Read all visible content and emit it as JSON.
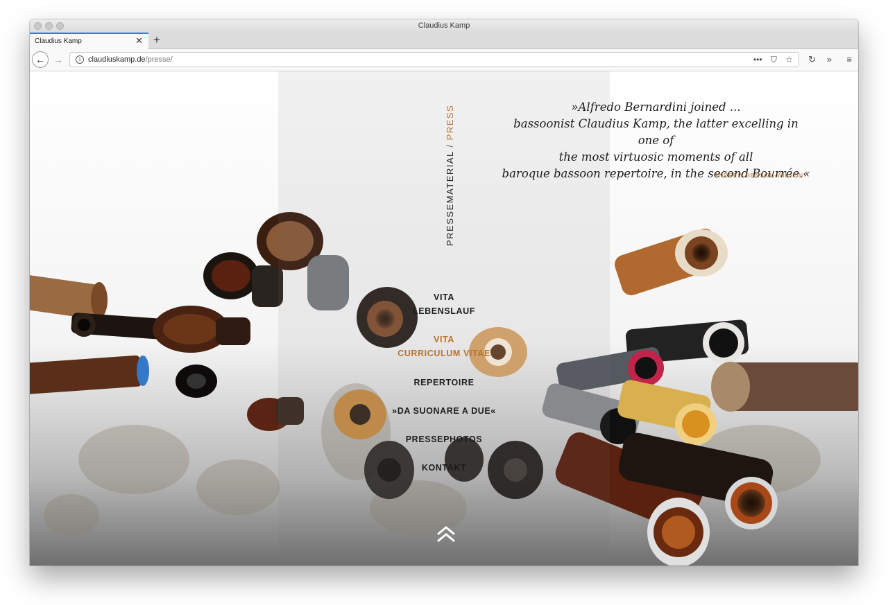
{
  "window": {
    "title": "Claudius Kamp"
  },
  "tab": {
    "label": "Claudius Kamp",
    "close_icon": "close-icon",
    "new_tab_icon": "plus-icon"
  },
  "navbar": {
    "url_host": "claudiuskamp.de",
    "url_path": "/presse/",
    "page_actions_icon": "ellipsis-icon",
    "pocket_icon": "pocket-icon",
    "bookmark_icon": "star-icon",
    "reload_icon": "reload-icon",
    "overflow_icon": "chevron-double-right-icon",
    "menu_icon": "hamburger-icon"
  },
  "page": {
    "vertical_title": {
      "main": "PRESSEMATERIAL",
      "separator": "/",
      "accent": "PRESS"
    },
    "quote": {
      "lines": [
        "»Alfredo Bernardini joined ...",
        "bassoonist Claudius Kamp, the latter excelling in one of",
        "the most virtuosic moments of all",
        "baroque bassoon repertoire, in the second Bourrée.«"
      ],
      "author": "ANDREW BENSON-WILSON"
    },
    "menu": [
      {
        "label_1": "VITA",
        "label_2": "LEBENSLAUF",
        "active": false
      },
      {
        "label_1": "VITA",
        "label_2": "CURRICULUM VITAE",
        "active": true
      },
      {
        "label_1": "REPERTOIRE",
        "active": false
      },
      {
        "label_1": "»DA SUONARE A DUE«",
        "active": false
      },
      {
        "label_1": "PRESSEPHOTOS",
        "active": false
      },
      {
        "label_1": "KONTAKT",
        "active": false
      }
    ],
    "scroll_up_icon": "double-chevron-up-icon",
    "colors": {
      "accent": "#b8742e",
      "text": "#1c1c1c"
    }
  }
}
